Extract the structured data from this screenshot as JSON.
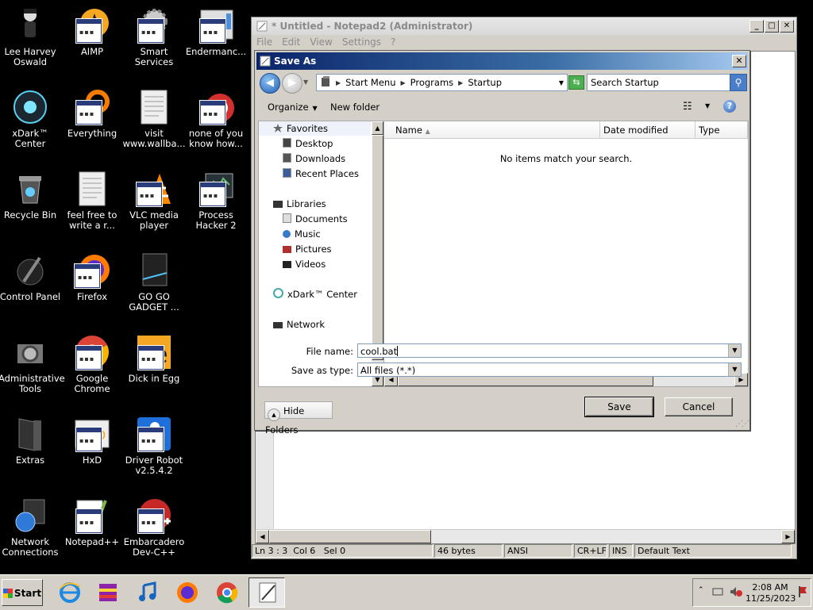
{
  "desktop": {
    "icons": [
      {
        "label": "Lee Harvey Oswald",
        "icon": "person-icon"
      },
      {
        "label": "AIMP",
        "icon": "aimp-icon"
      },
      {
        "label": "Smart Services",
        "icon": "gear-icon"
      },
      {
        "label": "Endermanc...",
        "icon": "app-icon"
      },
      {
        "label": "xDark™ Center",
        "icon": "orb-icon"
      },
      {
        "label": "Everything",
        "icon": "search-icon"
      },
      {
        "label": "visit www.wallba...",
        "icon": "document-icon"
      },
      {
        "label": "none of you know how...",
        "icon": "app-icon"
      },
      {
        "label": "Recycle Bin",
        "icon": "recycle-bin-icon"
      },
      {
        "label": "feel free to write a r...",
        "icon": "document-icon"
      },
      {
        "label": "VLC media player",
        "icon": "vlc-icon"
      },
      {
        "label": "Process Hacker 2",
        "icon": "app-icon"
      },
      {
        "label": "Control Panel",
        "icon": "control-panel-icon"
      },
      {
        "label": "Firefox",
        "icon": "firefox-icon"
      },
      {
        "label": "GO GO GADGET ...",
        "icon": "folder-icon"
      },
      {
        "label": "Administrative Tools",
        "icon": "tools-icon"
      },
      {
        "label": "Google Chrome",
        "icon": "chrome-icon"
      },
      {
        "label": "Dick in Egg",
        "icon": "app-icon"
      },
      {
        "label": "Extras",
        "icon": "folder-icon"
      },
      {
        "label": "HxD",
        "icon": "hex-editor-icon"
      },
      {
        "label": "Driver Robot v2.5.4.2",
        "icon": "robot-icon"
      },
      {
        "label": "Network Connections",
        "icon": "network-icon"
      },
      {
        "label": "Notepad++",
        "icon": "notepad-icon"
      },
      {
        "label": "Embarcadero Dev-C++",
        "icon": "devcpp-icon"
      }
    ]
  },
  "notepad": {
    "title": "* Untitled - Notepad2 (Administrator)",
    "menu": [
      "File",
      "Edit",
      "View",
      "Settings",
      "?"
    ],
    "status": {
      "position": "Ln 3 : 3",
      "col": "Col 6",
      "sel": "Sel 0",
      "size": "46 bytes",
      "encoding": "ANSI",
      "line_ending": "CR+LF",
      "ins": "INS",
      "scheme": "Default Text"
    }
  },
  "dialog": {
    "title": "Save As",
    "breadcrumb": [
      "Start Menu",
      "Programs",
      "Startup"
    ],
    "search_placeholder": "Search Startup",
    "toolbar": {
      "organize": "Organize",
      "new_folder": "New folder"
    },
    "nav": {
      "favorites": "Favorites",
      "desktop": "Desktop",
      "downloads": "Downloads",
      "recent": "Recent Places",
      "libraries": "Libraries",
      "documents": "Documents",
      "music": "Music",
      "pictures": "Pictures",
      "videos": "Videos",
      "xdark": "xDark™ Center",
      "network": "Network"
    },
    "columns": {
      "name": "Name",
      "date": "Date modified",
      "type": "Type"
    },
    "empty_message": "No items match your search.",
    "file_name_label": "File name:",
    "file_name_value": "cool.bat",
    "save_type_label": "Save as type:",
    "save_type_value": "All files (*.*)",
    "hide_folders": "Hide Folders",
    "save": "Save",
    "cancel": "Cancel"
  },
  "taskbar": {
    "start": "Start",
    "time": "2:08 AM",
    "date": "11/25/2023"
  }
}
